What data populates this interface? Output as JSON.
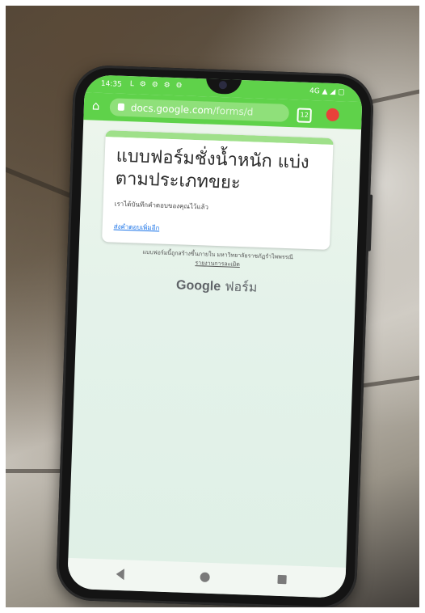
{
  "status_bar": {
    "time": "14:35",
    "left_indicators": "L ⚙ ⚙ ⚙ ⚙",
    "right_indicators": "4G ▲ ◢ ▢"
  },
  "browser": {
    "url_host": "docs.google.com",
    "url_path": "/forms/d",
    "tab_count": "12",
    "icons": [
      "home-icon",
      "lock-icon",
      "tabs-icon",
      "shield-icon"
    ]
  },
  "form": {
    "title": "แบบฟอร์มชั่งน้ำหนัก แบ่งตามประเภทขยะ",
    "confirmation": "เราได้บันทึกคำตอบของคุณไว้แล้ว",
    "resubmit_link": "ส่งคำตอบเพิ่มอีก"
  },
  "footer": {
    "note": "แบบฟอร์มนี้ถูกสร้างขึ้นภายใน มหาวิทยาลัยราชภัฏรำไพพรรณี",
    "report_link": "รายงานการละเมิด",
    "logo_google": "Google",
    "logo_forms": "ฟอร์ม"
  },
  "nav": {
    "icons": [
      "back-icon",
      "home-icon",
      "recents-icon"
    ]
  },
  "colors": {
    "browser_accent": "#5fd24a",
    "form_accent": "#9fe08a",
    "link": "#1a73e8"
  }
}
